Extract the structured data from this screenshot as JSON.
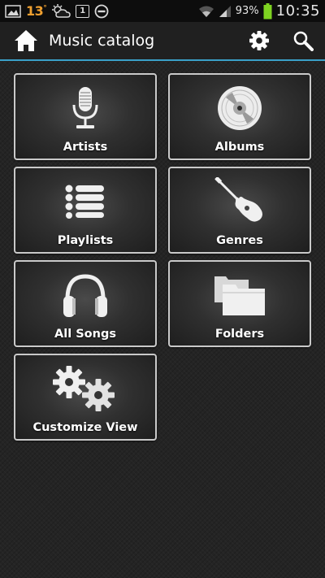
{
  "status_bar": {
    "temperature": "13",
    "temperature_unit": "°",
    "badge": "1",
    "battery": "93%",
    "time": "10:35",
    "icons": [
      "image-icon",
      "weather-icon",
      "calendar-badge-icon",
      "blocked-icon",
      "wifi-icon",
      "signal-icon",
      "battery-icon"
    ]
  },
  "action_bar": {
    "title": "Music catalog",
    "icons": [
      "home-icon",
      "settings-icon",
      "search-icon"
    ]
  },
  "tiles": [
    {
      "label": "Artists",
      "icon": "microphone-icon"
    },
    {
      "label": "Albums",
      "icon": "disc-icon"
    },
    {
      "label": "Playlists",
      "icon": "list-icon"
    },
    {
      "label": "Genres",
      "icon": "guitar-icon"
    },
    {
      "label": "All Songs",
      "icon": "headphones-icon"
    },
    {
      "label": "Folders",
      "icon": "folders-icon"
    },
    {
      "label": "Customize View",
      "icon": "gears-icon"
    }
  ],
  "colors": {
    "accent": "#3aa0c8",
    "background": "#242424",
    "tile_border": "#c9c9c9",
    "battery": "#7ed321",
    "weather_temp": "#f0a030"
  }
}
